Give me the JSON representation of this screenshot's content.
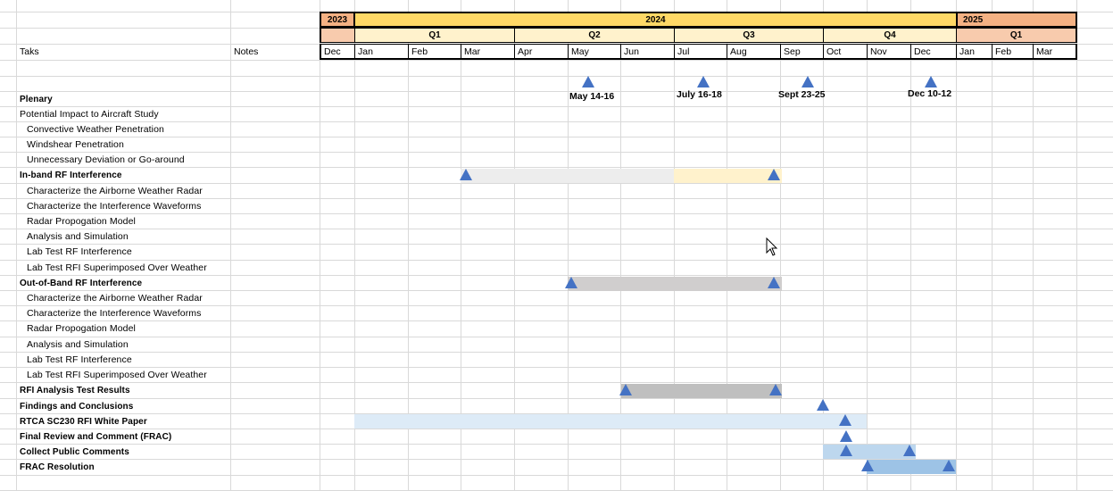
{
  "colors": {
    "year2023": "#f4b183",
    "year2024": "#ffd966",
    "year2025": "#f4b183",
    "quarter_fill": "#fff2cc",
    "dec_fill": "#f8cbad",
    "marker": "#4472c4",
    "bar_gray": "#d0cece",
    "bar_lightgray": "#ededed",
    "bar_yellow": "#fff2cc",
    "bar_lightblue": "#ddebf7",
    "bar_blue": "#9dc3e6"
  },
  "header": {
    "task_col": "Taks",
    "notes_col": "Notes",
    "years": [
      "2023",
      "2024",
      "2025"
    ],
    "quarters": [
      "Q1",
      "Q2",
      "Q3",
      "Q4",
      "Q1"
    ],
    "months": [
      "Dec",
      "Jan",
      "Feb",
      "Mar",
      "Apr",
      "May",
      "Jun",
      "Jul",
      "Aug",
      "Sep",
      "Oct",
      "Nov",
      "Dec",
      "Jan",
      "Feb",
      "Mar"
    ]
  },
  "plenary_meetings": [
    "May 14-16",
    "July 16-18",
    "Sept 23-25",
    "Dec 10-12"
  ],
  "tasks": [
    {
      "label": "Plenary",
      "style": "bold"
    },
    {
      "label": "Potential Impact to Aircraft Study",
      "style": "normal"
    },
    {
      "label": "Convective Weather Penetration",
      "style": "sub"
    },
    {
      "label": "Windshear Penetration",
      "style": "sub"
    },
    {
      "label": "Unnecessary Deviation or Go-around",
      "style": "sub"
    },
    {
      "label": "In-band RF Interference",
      "style": "bold"
    },
    {
      "label": "Characterize the Airborne Weather Radar",
      "style": "sub"
    },
    {
      "label": "Characterize the Interference Waveforms",
      "style": "sub"
    },
    {
      "label": "Radar Propogation Model",
      "style": "sub"
    },
    {
      "label": "Analysis and Simulation",
      "style": "sub"
    },
    {
      "label": "Lab Test RF Interference",
      "style": "sub"
    },
    {
      "label": "Lab Test RFI Superimposed Over Weather",
      "style": "sub"
    },
    {
      "label": "Out-of-Band RF Interference",
      "style": "bold"
    },
    {
      "label": "Characterize the Airborne Weather Radar",
      "style": "sub"
    },
    {
      "label": "Characterize the Interference Waveforms",
      "style": "sub"
    },
    {
      "label": "Radar Propogation Model",
      "style": "sub"
    },
    {
      "label": "Analysis and Simulation",
      "style": "sub"
    },
    {
      "label": "Lab Test RF Interference",
      "style": "sub"
    },
    {
      "label": "Lab Test RFI Superimposed Over Weather",
      "style": "sub"
    },
    {
      "label": "RFI Analysis Test Results",
      "style": "bold"
    },
    {
      "label": "Findings and Conclusions",
      "style": "bold"
    },
    {
      "label": "RTCA SC230 RFI White Paper",
      "style": "bold"
    },
    {
      "label": "Final Review and Comment (FRAC)",
      "style": "bold"
    },
    {
      "label": "Collect Public Comments",
      "style": "bold"
    },
    {
      "label": "FRAC Resolution",
      "style": "bold"
    }
  ]
}
